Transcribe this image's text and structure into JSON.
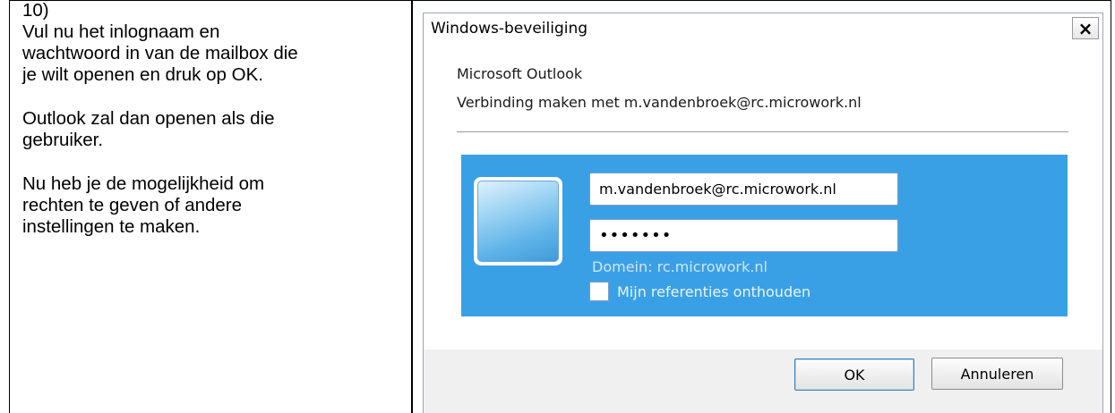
{
  "instructions": {
    "step": "10)",
    "paragraph1": "Vul nu het inlognaam en\nwachtwoord in van de mailbox die\nje wilt openen en druk op OK.",
    "paragraph2": "Outlook zal dan openen als die\ngebruiker.",
    "paragraph3": "Nu heb je de mogelijkheid om\nrechten te geven of andere\ninstellingen te maken."
  },
  "dialog": {
    "title": "Windows-beveiliging",
    "close_symbol": "×",
    "app_name": "Microsoft Outlook",
    "connecting_text": "Verbinding maken met m.vandenbroek@rc.microwork.nl",
    "username_value": "m.vandenbroek@rc.microwork.nl",
    "password_value": "•••••••",
    "domain_text": "Domein: rc.microwork.nl",
    "remember_label": "Mijn referenties onthouden",
    "remember_checked": false,
    "ok_label": "OK",
    "cancel_label": "Annuleren",
    "panel_color": "#3aa0e6"
  }
}
